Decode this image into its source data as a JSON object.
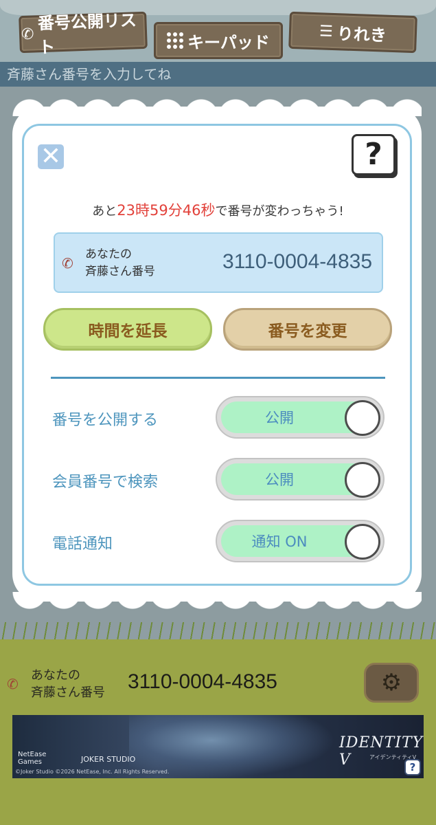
{
  "tabs": {
    "list_label": "番号公開リスト",
    "keypad_label": "キーパッド",
    "history_label": "りれき"
  },
  "input_placeholder": "斉藤さん番号を入力してね",
  "modal": {
    "countdown": {
      "prefix": "あと",
      "hours": "23",
      "hours_unit": "時",
      "minutes": "59",
      "minutes_unit": "分",
      "seconds": "46",
      "seconds_unit": "秒",
      "suffix": "で番号が変わっちゃう!"
    },
    "number_box": {
      "label_line1": "あなたの",
      "label_line2": "斉藤さん番号",
      "number": "3110-0004-4835"
    },
    "extend_button": "時間を延長",
    "change_button": "番号を変更",
    "settings": [
      {
        "label": "番号を公開する",
        "toggle_text": "公開"
      },
      {
        "label": "会員番号で検索",
        "toggle_text": "公開"
      },
      {
        "label": "電話通知",
        "toggle_text": "通知 ON"
      }
    ]
  },
  "footer": {
    "label_line1": "あなたの",
    "label_line2": "斉藤さん番号",
    "number": "3110-0004-4835"
  },
  "ad": {
    "netease_line1": "NetEase",
    "netease_line2": "Games",
    "joker": "JOKER STUDIO",
    "logo": "IDENTITY V",
    "logo_sub": "アイデンティティV",
    "copyright": "©Joker Studio ©2026 NetEase, Inc. All Rights Reserved.",
    "help": "?"
  },
  "colors": {
    "accent_blue": "#4d95bd",
    "countdown_red": "#e2413a",
    "toggle_on": "#aef2c6"
  }
}
